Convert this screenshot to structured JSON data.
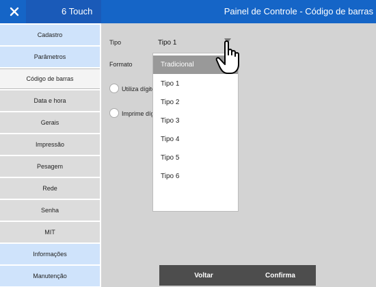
{
  "titlebar": {
    "app_name": "6 Touch",
    "window_title": "Painel de Controle - Código de barras"
  },
  "sidebar": {
    "items": [
      {
        "label": "Cadastro"
      },
      {
        "label": "Parâmetros"
      },
      {
        "label": "Código de barras"
      },
      {
        "label": "Data e hora"
      },
      {
        "label": "Gerais"
      },
      {
        "label": "Impressão"
      },
      {
        "label": "Pesagem"
      },
      {
        "label": "Rede"
      },
      {
        "label": "Senha"
      },
      {
        "label": "MIT"
      },
      {
        "label": "Informações"
      },
      {
        "label": "Manutenção"
      }
    ],
    "active_item": "Código de barras"
  },
  "form": {
    "tipo_label": "Tipo",
    "tipo_value": "Tipo 1",
    "formato_label": "Formato",
    "utiliza_label": "Utiliza dígito",
    "imprime_label": "Imprime díg"
  },
  "dropdown": {
    "options": [
      "Tradicional",
      "Tipo 1",
      "Tipo 2",
      "Tipo 3",
      "Tipo 4",
      "Tipo 5",
      "Tipo 6"
    ],
    "highlighted": "Tradicional"
  },
  "buttons": {
    "voltar": "Voltar",
    "confirma": "Confirma"
  },
  "icons": {
    "close": "close-icon",
    "cursor": "hand-pointer-icon",
    "select_arrow": "triangle-down-icon"
  },
  "colors": {
    "titlebar": "#1565c7",
    "sidebar_blue": "#cfe3fb",
    "sidebar_gray": "#dcdcdc",
    "panel": "#d3d3d3",
    "button": "#4d4d4d",
    "highlight": "#999999"
  }
}
